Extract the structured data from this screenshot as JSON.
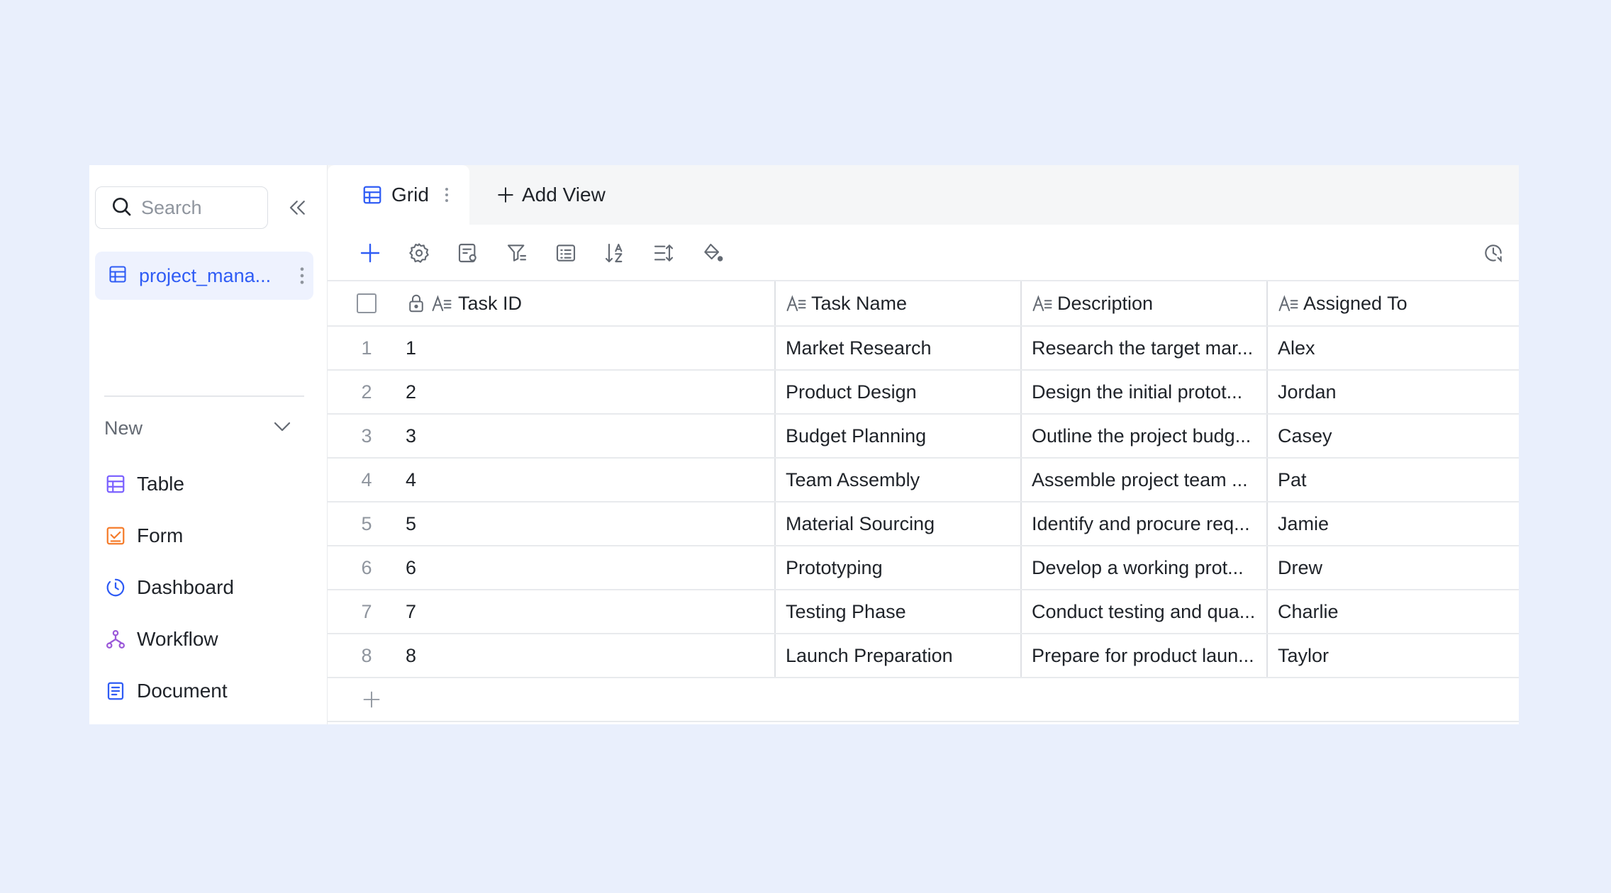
{
  "sidebar": {
    "search_placeholder": "Search",
    "table_item": "project_mana...",
    "new_label": "New",
    "new_items": [
      {
        "label": "Table",
        "icon": "table-icon"
      },
      {
        "label": "Form",
        "icon": "form-icon"
      },
      {
        "label": "Dashboard",
        "icon": "dashboard-icon"
      },
      {
        "label": "Workflow",
        "icon": "workflow-icon"
      },
      {
        "label": "Document",
        "icon": "document-icon"
      }
    ]
  },
  "tabs": {
    "grid_label": "Grid",
    "add_view_label": "Add View"
  },
  "toolbar": {
    "icons": [
      "add-icon",
      "settings-icon",
      "field-config-icon",
      "filter-icon",
      "group-icon",
      "sort-icon",
      "row-height-icon",
      "fill-color-icon"
    ],
    "history_icon": "history-icon"
  },
  "grid": {
    "columns": [
      "Task ID",
      "Task Name",
      "Description",
      "Assigned To"
    ],
    "rows": [
      {
        "idx": "1",
        "id": "1",
        "name": "Market Research",
        "desc": "Research the target mar...",
        "assign": "Alex"
      },
      {
        "idx": "2",
        "id": "2",
        "name": "Product Design",
        "desc": "Design the initial protot...",
        "assign": "Jordan"
      },
      {
        "idx": "3",
        "id": "3",
        "name": "Budget Planning",
        "desc": "Outline the project budg...",
        "assign": "Casey"
      },
      {
        "idx": "4",
        "id": "4",
        "name": "Team Assembly",
        "desc": "Assemble project team ...",
        "assign": "Pat"
      },
      {
        "idx": "5",
        "id": "5",
        "name": "Material Sourcing",
        "desc": "Identify and procure req...",
        "assign": "Jamie"
      },
      {
        "idx": "6",
        "id": "6",
        "name": "Prototyping",
        "desc": "Develop a working prot...",
        "assign": "Drew"
      },
      {
        "idx": "7",
        "id": "7",
        "name": "Testing Phase",
        "desc": "Conduct testing and qua...",
        "assign": "Charlie"
      },
      {
        "idx": "8",
        "id": "8",
        "name": "Launch Preparation",
        "desc": "Prepare for product laun...",
        "assign": "Taylor"
      }
    ]
  },
  "colors": {
    "accent": "#2f5cf5",
    "background": "#e9effc",
    "form_orange": "#f57c2b",
    "table_purple": "#7b61ff"
  }
}
